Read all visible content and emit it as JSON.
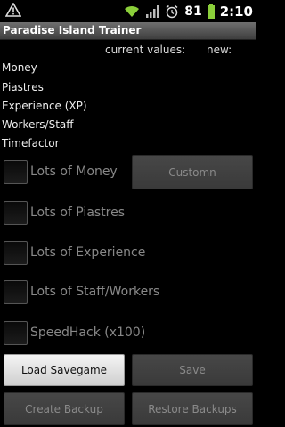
{
  "status_bar": {
    "battery_level": "81",
    "time": "2:10",
    "icons": [
      "warning-icon",
      "wifi-icon",
      "signal-icon",
      "alarm-icon",
      "battery-icon"
    ]
  },
  "app": {
    "title": "Paradise Island Trainer"
  },
  "columns": {
    "current": "current values:",
    "new": "new:"
  },
  "fields": [
    "Money",
    "Piastres",
    "Experience (XP)",
    "Workers/Staff",
    "Timefactor"
  ],
  "checkboxes": [
    "Lots of Money",
    "Lots of Piastres",
    "Lots of Experience",
    "Lots of Staff/Workers",
    "SpeedHack (x100)"
  ],
  "buttons": {
    "custom": "Customn",
    "load": "Load Savegame",
    "save": "Save",
    "create_backup": "Create Backup",
    "restore_backups": "Restore Backups"
  }
}
